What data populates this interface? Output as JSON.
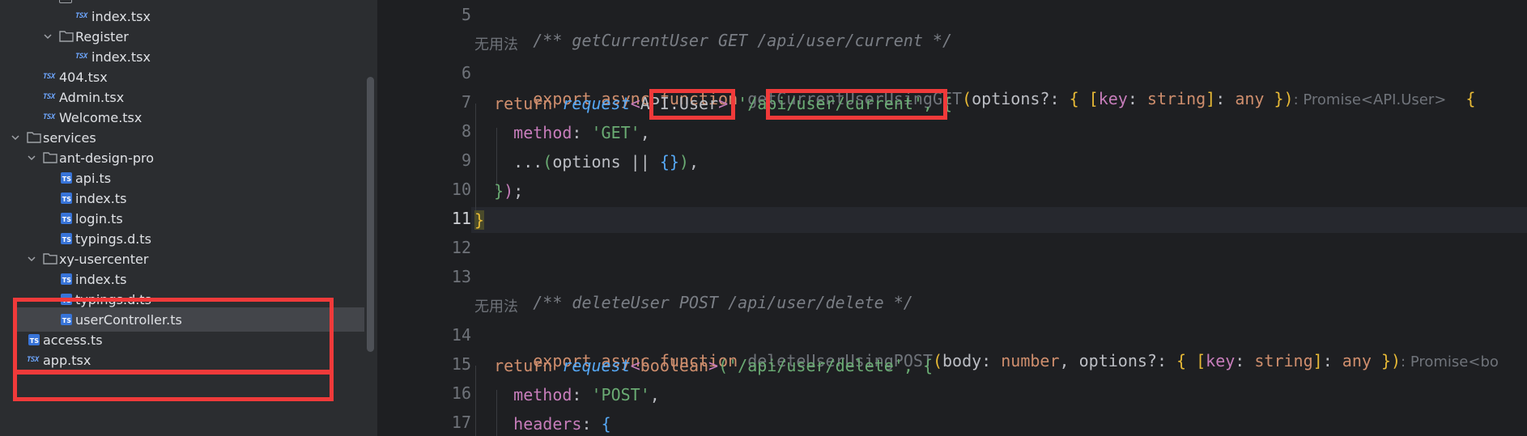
{
  "tree": {
    "items": [
      {
        "kind": "file-tsx",
        "label": "index.tsx"
      },
      {
        "kind": "folder",
        "label": "Register",
        "expanded": true
      },
      {
        "kind": "file-tsx",
        "label": "index.tsx"
      },
      {
        "kind": "file-tsx",
        "label": "404.tsx"
      },
      {
        "kind": "file-tsx",
        "label": "Admin.tsx"
      },
      {
        "kind": "file-tsx",
        "label": "Welcome.tsx"
      },
      {
        "kind": "folder",
        "label": "services",
        "expanded": true
      },
      {
        "kind": "folder",
        "label": "ant-design-pro",
        "expanded": true
      },
      {
        "kind": "file-ts",
        "label": "api.ts"
      },
      {
        "kind": "file-ts",
        "label": "index.ts"
      },
      {
        "kind": "file-ts",
        "label": "login.ts"
      },
      {
        "kind": "file-ts",
        "label": "typings.d.ts"
      },
      {
        "kind": "folder",
        "label": "xy-usercenter",
        "expanded": true
      },
      {
        "kind": "file-ts",
        "label": "index.ts"
      },
      {
        "kind": "file-ts",
        "label": "typings.d.ts"
      },
      {
        "kind": "file-ts",
        "label": "userController.ts",
        "selected": true
      },
      {
        "kind": "file-ts",
        "label": "access.ts"
      },
      {
        "kind": "file-tsx",
        "label": "app.tsx"
      }
    ],
    "tsx_badge": "TSX",
    "ts_badge": "TS"
  },
  "editor": {
    "line_numbers": [
      "5",
      "6",
      "7",
      "8",
      "9",
      "10",
      "11",
      "12",
      "13",
      "14",
      "15",
      "16",
      "17"
    ],
    "current_line": "11",
    "usage_hint": "无用法",
    "line5": "/** getCurrentUser GET /api/user/current */",
    "line6": {
      "kw1": "export",
      "kw2": "async",
      "kw3": "function",
      "fn": "getCurrentUserUsingGET",
      "open": "(",
      "param": "options?: ",
      "b1": "{ ",
      "b2": "[",
      "key": "key",
      "colon": ": ",
      "type1": "string",
      "b3": "]",
      "colon2": ": ",
      "type2": "any",
      "b4": " }",
      "close": ")",
      "hint": ": Promise<API.User>",
      "open_brace": "{"
    },
    "line7": {
      "kw": "return",
      "fn": "request",
      "lt": "<",
      "generic": "API.User",
      "gt": ">",
      "open": "('",
      "path": "/api/user/current",
      "close": "', ",
      "brace": "{"
    },
    "line8": {
      "prop": "method",
      "colon": ": ",
      "value": "'GET'",
      "comma": ","
    },
    "line9": {
      "spread": "...",
      "open": "(",
      "name": "options",
      "op": " || ",
      "obj": "{}",
      "close": ")",
      "comma": ","
    },
    "line10": {
      "brace": "}",
      "paren": ")",
      "semi": ";"
    },
    "line11": "}",
    "line13": "/** deleteUser POST /api/user/delete */",
    "line14": {
      "kw1": "export",
      "kw2": "async",
      "kw3": "function",
      "fn": "deleteUserUsingPOST",
      "open": "(",
      "param1": "body: ",
      "type0": "number",
      "comma": ", ",
      "param": "options?: ",
      "b1": "{ ",
      "b2": "[",
      "key": "key",
      "colon": ": ",
      "type1": "string",
      "b3": "]",
      "colon2": ": ",
      "type2": "any",
      "b4": " }",
      "close": ")",
      "hint": ": Promise<bo"
    },
    "line15": {
      "kw": "return",
      "fn": "request",
      "lt": "<",
      "generic": "boolean",
      "gt": ">",
      "open": "('",
      "path": "/api/user/delete",
      "close": "', ",
      "brace": "{"
    },
    "line16": {
      "prop": "method",
      "colon": ": ",
      "value": "'POST'",
      "comma": ","
    },
    "line17": {
      "prop": "headers",
      "colon": ": ",
      "brace": "{"
    }
  },
  "colors": {
    "highlight_box": "#f03a3a",
    "tree_bg": "#2b2d30",
    "editor_bg": "#1e1f22"
  }
}
